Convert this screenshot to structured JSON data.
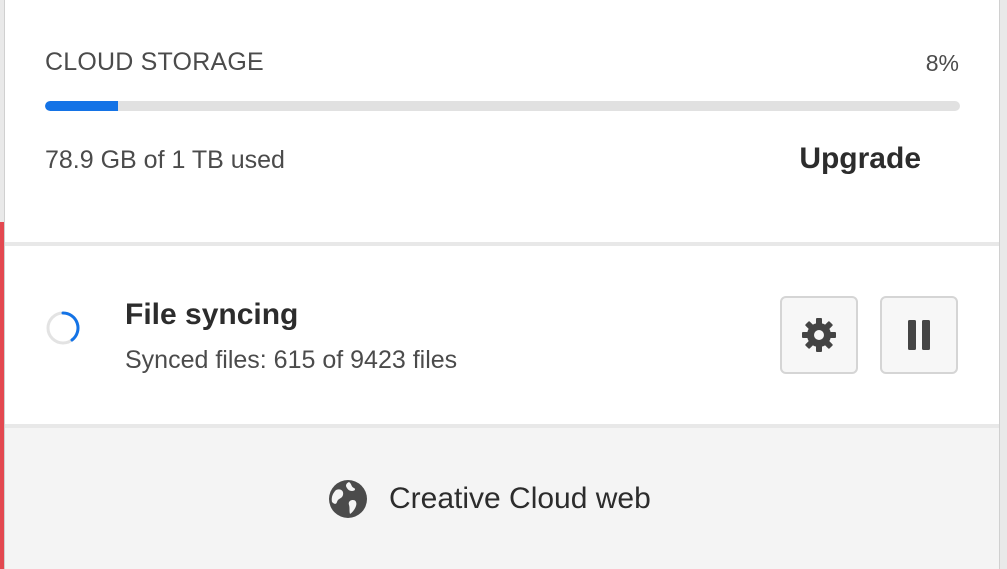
{
  "storage": {
    "title": "CLOUD STORAGE",
    "percent_label": "8%",
    "percent_used": 8,
    "used_label": "78.9 GB of 1 TB used",
    "upgrade_label": "Upgrade",
    "meter_color": "#1473e6"
  },
  "sync": {
    "title": "File syncing",
    "status": "Synced files: 615 of 9423 files",
    "status_icon": "loading-spinner-icon",
    "settings_icon": "gear-icon",
    "pause_icon": "pause-icon"
  },
  "footer": {
    "link_label": "Creative Cloud web",
    "link_icon": "globe-icon"
  },
  "colors": {
    "accent": "#1473e6",
    "text_primary": "#2c2c2c",
    "text_secondary": "#4b4b4b"
  }
}
